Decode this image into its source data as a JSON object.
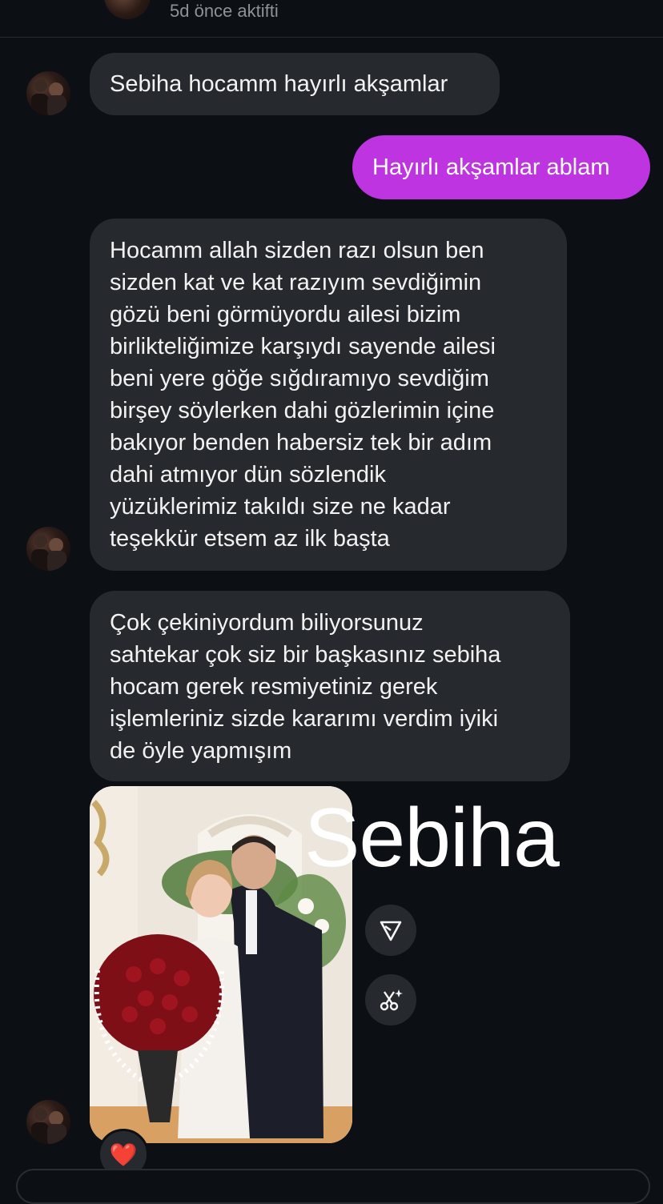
{
  "header": {
    "status": "5d önce aktifti",
    "icons": [
      "back-arrow-icon",
      "sticker-face-icon",
      "phone-icon",
      "video-camera-icon"
    ]
  },
  "messages": [
    {
      "from": "them",
      "text": "Sebiha hocamm hayırlı akşamlar"
    },
    {
      "from": "me",
      "text": "Hayırlı akşamlar ablam"
    },
    {
      "from": "them",
      "lines": [
        "Hocamm allah sizden razı olsun ben",
        "sizden kat ve kat razıyım sevdiğimin",
        "gözü beni görmüyordu ailesi bizim",
        "birlikteliğimize karşıydı sayende ailesi",
        "beni yere göğe sığdıramıyo sevdiğim",
        "birşey söylerken dahi gözlerimin içine",
        "bakıyor benden habersiz tek bir adım",
        "dahi atmıyor dün sözlendik",
        "yüzüklerimiz takıldı size ne kadar",
        "teşekkür etsem az ilk başta"
      ]
    },
    {
      "from": "them",
      "lines": [
        "Çok çekiniyordum biliyorsunuz",
        "sahtekar çok siz bir başkasınız sebiha",
        "hocam gerek resmiyetiniz gerek",
        "işlemleriniz sizde kararımı verdim iyiki",
        "de öyle yapmışım"
      ]
    }
  ],
  "photo_message": {
    "overlay_text": "Sebiha",
    "actions": [
      "share-icon",
      "ai-edit-icon"
    ],
    "reaction": "❤️"
  },
  "colors": {
    "background": "#0c1014",
    "incoming_bubble": "#262a2f",
    "outgoing_bubble": "#bd34e0",
    "status_text": "#8e9296"
  }
}
